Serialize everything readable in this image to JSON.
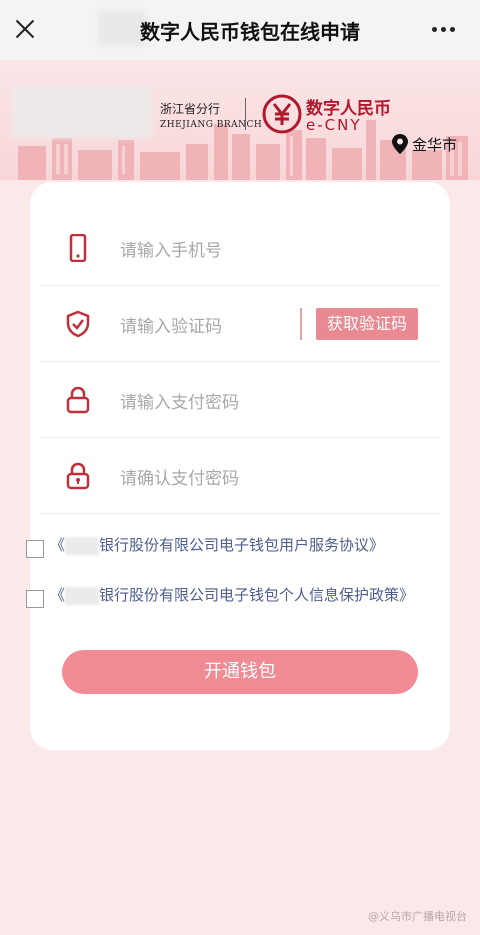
{
  "header": {
    "title": "数字人民币钱包在线申请",
    "close_icon": "close-icon",
    "more_icon": "more-icon"
  },
  "banner": {
    "branch_cn": "浙江省分行",
    "branch_en": "ZHEJIANG BRANCH",
    "ecny_cn": "数字人民币",
    "ecny_en": "e-CNY",
    "city": "金华市"
  },
  "form": {
    "phone_placeholder": "请输入手机号",
    "code_placeholder": "请输入验证码",
    "get_code_label": "获取验证码",
    "pay_password_placeholder": "请输入支付密码",
    "confirm_password_placeholder": "请确认支付密码"
  },
  "agreements": [
    {
      "prefix": "《",
      "text": "银行股份有限公司电子钱包用户服务协议》"
    },
    {
      "prefix": "《",
      "text": "银行股份有限公司电子钱包个人信息保护政策》"
    }
  ],
  "submit_label": "开通钱包",
  "watermark": "@义乌市广播电视台",
  "colors": {
    "accent": "#f08b94",
    "brand_red": "#b2182b",
    "link": "#4e5e8e",
    "background": "#fbe9ea"
  }
}
